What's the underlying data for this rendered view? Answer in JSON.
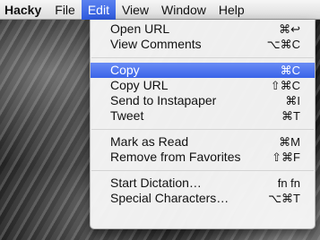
{
  "menubar": {
    "items": [
      "Hacky",
      "File",
      "Edit",
      "View",
      "Window",
      "Help"
    ]
  },
  "menu": {
    "groups": [
      [
        {
          "label": "Open URL",
          "shortcut": "⌘↩"
        },
        {
          "label": "View Comments",
          "shortcut": "⌥⌘C"
        }
      ],
      [
        {
          "label": "Copy",
          "shortcut": "⌘C",
          "highlighted": true
        },
        {
          "label": "Copy URL",
          "shortcut": "⇧⌘C"
        },
        {
          "label": "Send to Instapaper",
          "shortcut": "⌘I"
        },
        {
          "label": "Tweet",
          "shortcut": "⌘T"
        }
      ],
      [
        {
          "label": "Mark as Read",
          "shortcut": "⌘M"
        },
        {
          "label": "Remove from Favorites",
          "shortcut": "⇧⌘F"
        }
      ],
      [
        {
          "label": "Start Dictation…",
          "shortcut": "fn fn"
        },
        {
          "label": "Special Characters…",
          "shortcut": "⌥⌘T"
        }
      ]
    ]
  },
  "colors": {
    "highlight": "#3a63e8"
  }
}
